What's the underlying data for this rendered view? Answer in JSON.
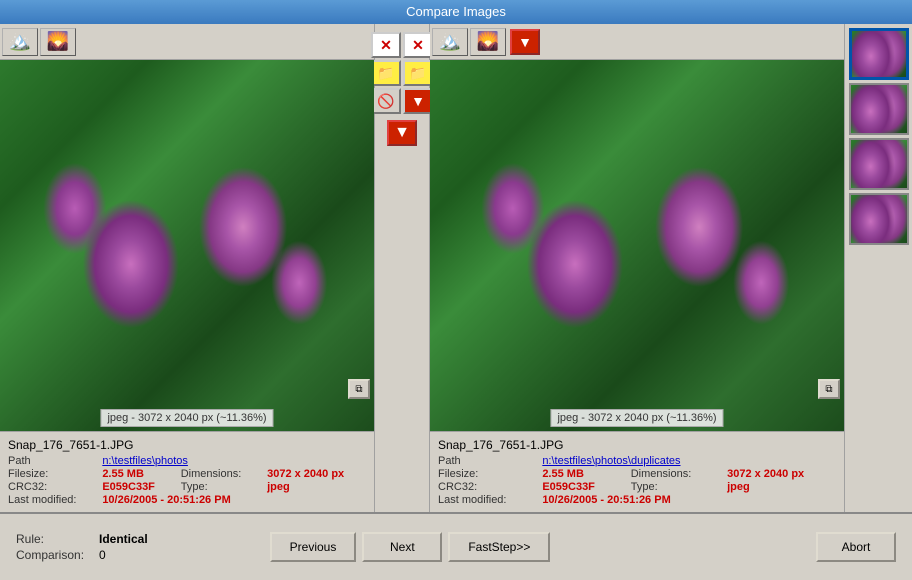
{
  "window": {
    "title": "Compare Images"
  },
  "left": {
    "filename": "Snap_176_7651-1.JPG",
    "path_label": "Path",
    "path_value": "n:\\testfiles\\photos",
    "filesize_label": "Filesize:",
    "filesize_value": "2.55 MB",
    "dimensions_label": "Dimensions:",
    "dimensions_value": "3072 x 2040 px",
    "crc_label": "CRC32:",
    "crc_value": "E059C33F",
    "type_label": "Type:",
    "type_value": "jpeg",
    "modified_label": "Last modified:",
    "modified_value": "10/26/2005 - 20:51:26 PM",
    "img_info": "jpeg - 3072 x 2040 px (~11.36%)"
  },
  "right": {
    "filename": "Snap_176_7651-1.JPG",
    "path_label": "Path",
    "path_value": "n:\\testfiles\\photos\\duplicates",
    "filesize_label": "Filesize:",
    "filesize_value": "2.55 MB",
    "dimensions_label": "Dimensions:",
    "dimensions_value": "3072 x 2040 px",
    "crc_label": "CRC32:",
    "crc_value": "E059C33F",
    "type_label": "Type:",
    "type_value": "jpeg",
    "modified_label": "Last modified:",
    "modified_value": "10/26/2005 - 20:51:26 PM",
    "img_info": "jpeg - 3072 x 2040 px (~11.36%)"
  },
  "bottom": {
    "rule_label": "Rule:",
    "rule_value": "Identical",
    "comparison_label": "Comparison:",
    "comparison_value": "0",
    "prev_btn": "Previous",
    "next_btn": "Next",
    "faststep_btn": "FastStep>>",
    "abort_btn": "Abort"
  }
}
